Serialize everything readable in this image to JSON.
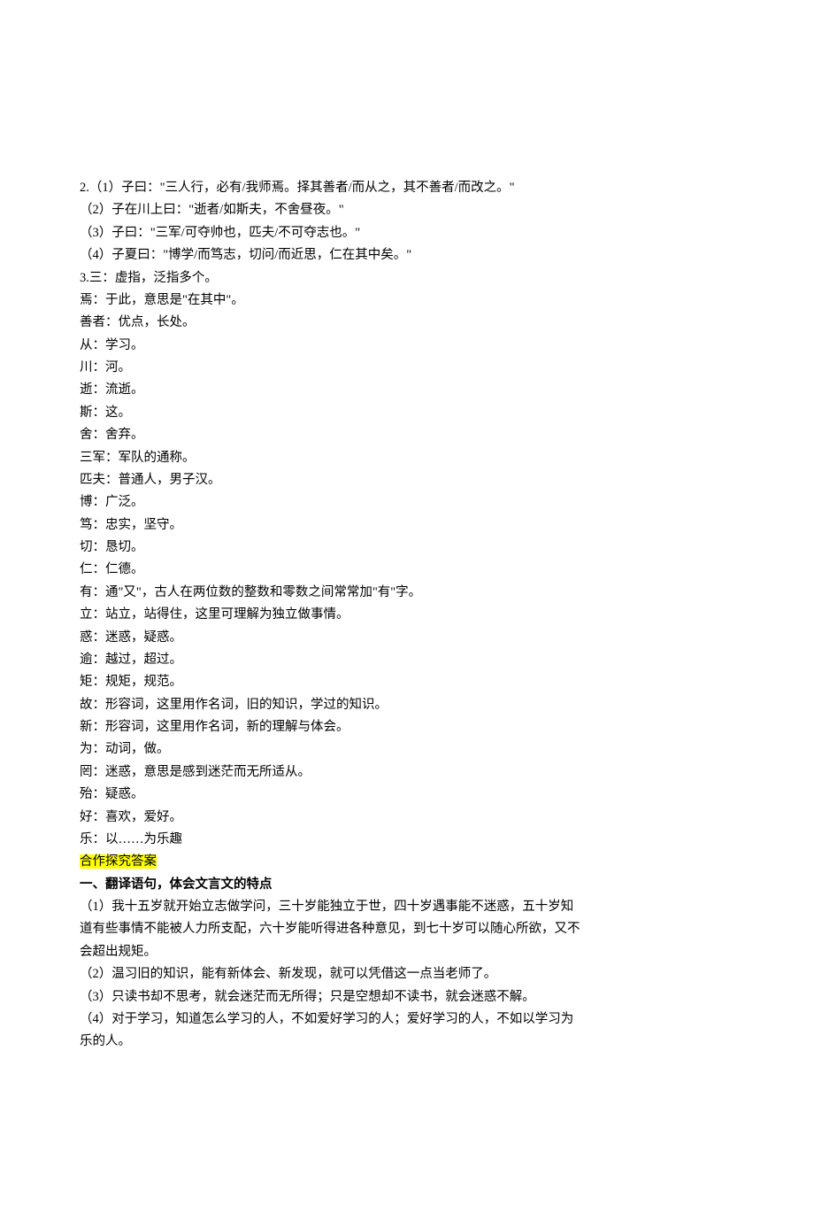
{
  "lines": [
    {
      "text": "2.（1）子曰：\"三人行，必有/我师焉。择其善者/而从之，其不善者/而改之。\""
    },
    {
      "text": "（2）子在川上曰：\"逝者/如斯夫，不舍昼夜。\""
    },
    {
      "text": "（3）子曰：\"三军/可夺帅也，匹夫/不可夺志也。\""
    },
    {
      "text": "（4）子夏曰：\"博学/而笃志，切问/而近思，仁在其中矣。\""
    },
    {
      "text": "3.三：虚指，泛指多个。"
    },
    {
      "text": "焉：于此，意思是\"在其中\"。"
    },
    {
      "text": "善者：优点，长处。"
    },
    {
      "text": "从：学习。"
    },
    {
      "text": "川：河。"
    },
    {
      "text": "逝：流逝。"
    },
    {
      "text": "斯：这。"
    },
    {
      "text": "舍：舍弃。"
    },
    {
      "text": "三军：军队的通称。"
    },
    {
      "text": "匹夫：普通人，男子汉。"
    },
    {
      "text": "博：广泛。"
    },
    {
      "text": "笃：忠实，坚守。"
    },
    {
      "text": "切：恳切。"
    },
    {
      "text": "仁：仁德。"
    },
    {
      "text": "有：通\"又\"，古人在两位数的整数和零数之间常常加\"有\"字。"
    },
    {
      "text": "立：站立，站得住，这里可理解为独立做事情。"
    },
    {
      "text": "惑：迷惑，疑惑。"
    },
    {
      "text": "逾：越过，超过。"
    },
    {
      "text": "矩：规矩，规范。"
    },
    {
      "text": "故：形容词，这里用作名词，旧的知识，学过的知识。"
    },
    {
      "text": "新：形容词，这里用作名词，新的理解与体会。"
    },
    {
      "text": "为：动词，做。"
    },
    {
      "text": "罔：迷惑，意思是感到迷茫而无所适从。"
    },
    {
      "text": "殆：疑惑。"
    },
    {
      "text": "好：喜欢，爱好。"
    },
    {
      "text": "乐：以……为乐趣"
    },
    {
      "text": "合作探究答案",
      "highlight": true
    },
    {
      "text": "一、翻译语句，体会文言文的特点",
      "bold": true
    },
    {
      "text": "（1）我十五岁就开始立志做学问，三十岁能独立于世，四十岁遇事能不迷惑，五十岁知道有些事情不能被人力所支配，六十岁能听得进各种意见，到七十岁可以随心所欲，又不会超出规矩。"
    },
    {
      "text": "（2）温习旧的知识，能有新体会、新发现，就可以凭借这一点当老师了。"
    },
    {
      "text": "（3）只读书却不思考，就会迷茫而无所得；只是空想却不读书，就会迷惑不解。"
    },
    {
      "text": "（4）对于学习，知道怎么学习的人，不如爱好学习的人；爱好学习的人，不如以学习为乐的人。"
    }
  ]
}
